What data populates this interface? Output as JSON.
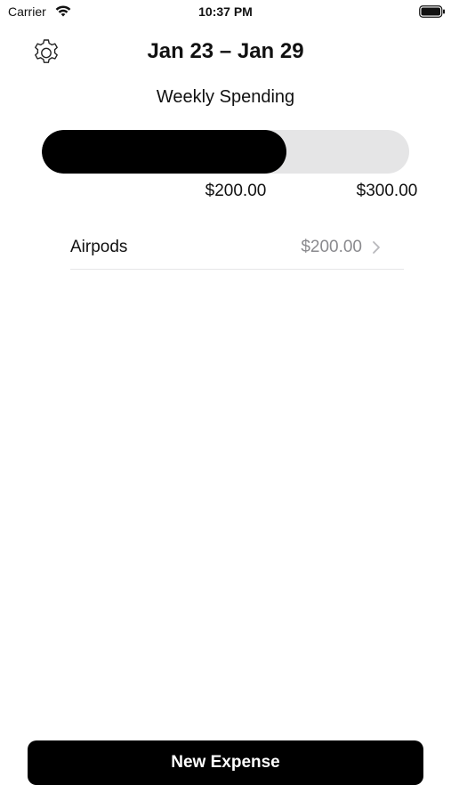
{
  "status_bar": {
    "carrier": "Carrier",
    "time": "10:37 PM",
    "icons": [
      "wifi-icon",
      "battery-icon"
    ]
  },
  "header": {
    "settings_icon": "gear-icon",
    "date_range": "Jan 23 – Jan 29",
    "subtitle": "Weekly Spending"
  },
  "spending": {
    "spent_label": "$200.00",
    "budget_label": "$300.00",
    "progress_fraction": 0.667,
    "fill_color": "#000000",
    "track_color": "#e5e5e6"
  },
  "expenses": [
    {
      "name": "Airpods",
      "amount": "$200.00"
    }
  ],
  "actions": {
    "new_expense_label": "New Expense"
  }
}
